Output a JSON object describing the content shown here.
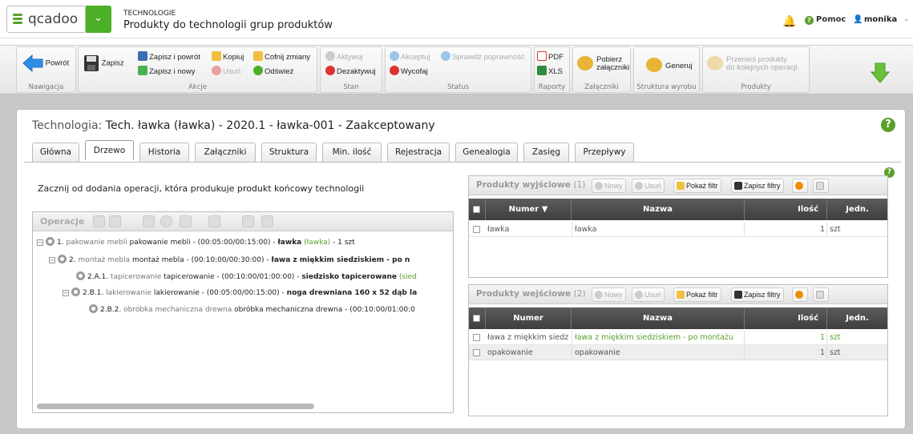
{
  "app": {
    "logo": "qcadoo",
    "section": "TECHNOLOGIE",
    "title": "Produkty do technologii grup produktów"
  },
  "user_bar": {
    "help_label": "Pomoc",
    "user_label": "monika"
  },
  "ribbon": {
    "groups": {
      "nav": "Nawigacja",
      "actions": "Akcje",
      "state": "Stan",
      "status": "Status",
      "reports": "Raporty",
      "attachments": "Załączniki",
      "structure": "Struktura wyrobu",
      "products": "Produkty"
    },
    "back": "Powrót",
    "save": "Zapisz",
    "save_back": "Zapisz i powrót",
    "save_new": "Zapisz i nowy",
    "copy": "Kopiuj",
    "delete": "Usuń",
    "undo": "Cofnij zmiany",
    "refresh": "Odśwież",
    "activate": "Aktywuj",
    "deactivate": "Dezaktywuj",
    "accept": "Akceptuj",
    "check": "Sprawdź poprawność",
    "withdraw": "Wycofaj",
    "pdf": "PDF",
    "xls": "XLS",
    "download_attachments_1": "Pobierz",
    "download_attachments_2": "załączniki",
    "generate": "Generuj",
    "move_products_1": "Przenieś produkty",
    "move_products_2": "do kolejnych operacji"
  },
  "doc": {
    "label": "Technologia:",
    "value": "Tech. ławka (ławka) - 2020.1 - ławka-001 - Zaakceptowany"
  },
  "tabs": [
    "Główna",
    "Drzewo",
    "Historia",
    "Załączniki",
    "Struktura",
    "Min. ilość",
    "Rejestracja",
    "Genealogia",
    "Zasięg",
    "Przepływy"
  ],
  "hint": "Zacznij od dodania operacji, która produkuje produkt końcowy technologii",
  "operations": {
    "title": "Operacje",
    "rows": [
      {
        "num": "1.",
        "name_grey": "pakowanie mebli",
        "name": "pakowanie mebli",
        "times": "- (00:05:00/00:15:00) -",
        "product": "ławka",
        "product_g": "(ławka)",
        "qty": "- 1 szt"
      },
      {
        "num": "2.",
        "name_grey": "montaż mebla",
        "name": "montaż mebla",
        "times": "- (00:10:00/00:30:00) -",
        "product": "ława z miękkim siedziskiem - po n",
        "product_g": "",
        "qty": ""
      },
      {
        "num": "2.A.1.",
        "name_grey": "tapicerowanie",
        "name": "tapicerowanie",
        "times": "- (00:10:00/01:00:00) -",
        "product": "siedzisko tapicerowane",
        "product_g": "(sied",
        "qty": ""
      },
      {
        "num": "2.B.1.",
        "name_grey": "lakierowanie",
        "name": "lakierowanie",
        "times": "- (00:05:00/00:15:00) -",
        "product": "noga drewniana 160 x 52 dąb la",
        "product_g": "",
        "qty": ""
      },
      {
        "num": "2.B.2.",
        "name_grey": "obróbka mechaniczna drewna",
        "name": "obróbka mechaniczna drewna",
        "times": "- (00:10:00/01:00:0",
        "product": "",
        "product_g": "",
        "qty": ""
      }
    ]
  },
  "output_grid": {
    "title": "Produkty wyjściowe",
    "count": "(1)",
    "new": "Nowy",
    "delete": "Usuń",
    "filter": "Pokaż filtr",
    "save_filters": "Zapisz filtry",
    "columns": [
      "Numer",
      "Nazwa",
      "Ilość",
      "Jedn."
    ],
    "rows": [
      {
        "num": "ławka",
        "name": "ławka",
        "qty": "1",
        "unit": "szt"
      }
    ]
  },
  "input_grid": {
    "title": "Produkty wejściowe",
    "count": "(2)",
    "new": "Nowy",
    "delete": "Usuń",
    "filter": "Pokaż filtr",
    "save_filters": "Zapisz filtry",
    "columns": [
      "Numer",
      "Nazwa",
      "Ilość",
      "Jedn."
    ],
    "rows": [
      {
        "num": "ława z miękkim siedz",
        "name": "ława z miękkim siedziskiem - po montażu",
        "qty": "1",
        "unit": "szt"
      },
      {
        "num": "opakowanie",
        "name": "opakowanie",
        "qty": "1",
        "unit": "szt"
      }
    ]
  },
  "colors": {
    "accent": "#5aa02c",
    "header_dark": "#4a4a4a",
    "bell": "#f0a000"
  }
}
